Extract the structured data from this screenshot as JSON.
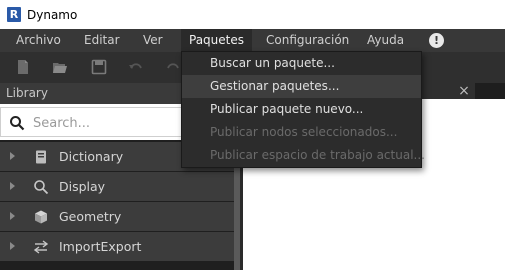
{
  "window": {
    "title": "Dynamo",
    "logo_letter": "R"
  },
  "menubar": {
    "items": [
      {
        "label": "Archivo"
      },
      {
        "label": "Editar"
      },
      {
        "label": "Ver"
      },
      {
        "label": "Paquetes",
        "active": true
      },
      {
        "label": "Configuración"
      },
      {
        "label": "Ayuda"
      }
    ],
    "alert_glyph": "!"
  },
  "toolbar": {
    "icons": [
      "new-file-icon",
      "open-folder-icon",
      "save-icon",
      "undo-icon",
      "redo-icon"
    ]
  },
  "library": {
    "title": "Library",
    "search": {
      "placeholder": "Search...",
      "value": ""
    },
    "items": [
      {
        "label": "Dictionary",
        "icon": "dictionary-icon"
      },
      {
        "label": "Display",
        "icon": "display-search-icon"
      },
      {
        "label": "Geometry",
        "icon": "cube-icon"
      },
      {
        "label": "ImportExport",
        "icon": "import-export-icon"
      }
    ]
  },
  "workspace": {
    "close_glyph": "×"
  },
  "packages_menu": {
    "items": [
      {
        "label": "Buscar un paquete...",
        "enabled": true,
        "highlighted": false
      },
      {
        "label": "Gestionar paquetes...",
        "enabled": true,
        "highlighted": true
      },
      {
        "label": "Publicar paquete nuevo...",
        "enabled": true,
        "highlighted": false
      },
      {
        "label": "Publicar nodos seleccionados...",
        "enabled": false,
        "highlighted": false
      },
      {
        "label": "Publicar espacio de trabajo actual...",
        "enabled": false,
        "highlighted": false
      }
    ]
  },
  "colors": {
    "menubar_bg": "#383838",
    "dropdown_bg": "#2c2c2c",
    "highlight_bg": "#3e3e3e",
    "disabled_text": "#6a6a6a",
    "library_row_bg": "#3c3c3c"
  }
}
